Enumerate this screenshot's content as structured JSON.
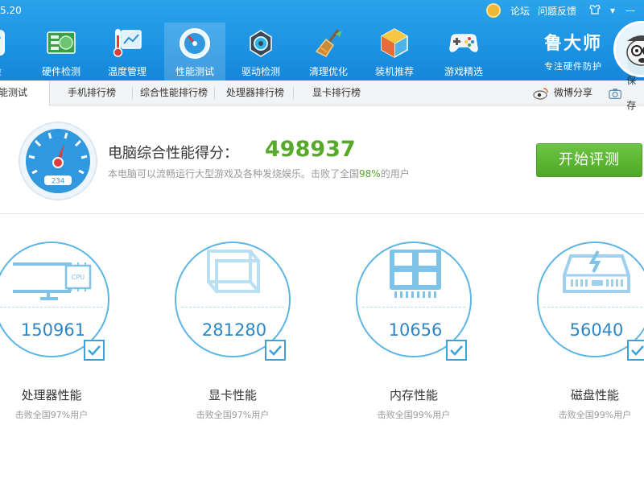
{
  "header": {
    "version": "5.20",
    "links": [
      "论坛",
      "问题反馈"
    ],
    "window_buttons": [
      "▾",
      "—"
    ],
    "brand_title": "鲁大师",
    "brand_subtitle": "专注硬件防护"
  },
  "nav": [
    {
      "label": "体检",
      "icon": "checkup-icon"
    },
    {
      "label": "硬件检测",
      "icon": "hardware-board-icon"
    },
    {
      "label": "温度管理",
      "icon": "thermometer-icon"
    },
    {
      "label": "性能测试",
      "icon": "speedometer-icon",
      "active": true
    },
    {
      "label": "驱动检测",
      "icon": "driver-gear-icon"
    },
    {
      "label": "清理优化",
      "icon": "broom-icon"
    },
    {
      "label": "装机推荐",
      "icon": "cube-icon"
    },
    {
      "label": "游戏精选",
      "icon": "gamepad-icon"
    }
  ],
  "tabs": [
    {
      "label": "性能测试",
      "active": true
    },
    {
      "label": "手机排行榜"
    },
    {
      "label": "综合性能排行榜"
    },
    {
      "label": "处理器排行榜"
    },
    {
      "label": "显卡排行榜"
    }
  ],
  "share": {
    "weibo": "微博分享",
    "save": "保存"
  },
  "score": {
    "label": "电脑综合性能得分：",
    "value": "498937",
    "desc_prefix": "本电脑可以流畅运行大型游戏及各种发烧娱乐。击败了全国",
    "desc_pct": "98%",
    "desc_suffix": "的用户",
    "gauge_readout": "234"
  },
  "start_button": "开始评测",
  "components": [
    {
      "name": "处理器性能",
      "score": "150961",
      "desc": "击败全国97%用户",
      "icon": "cpu-monitor-icon",
      "chip_text": "CPU"
    },
    {
      "name": "显卡性能",
      "score": "281280",
      "desc": "击败全国97%用户",
      "icon": "gpu-cube-icon"
    },
    {
      "name": "内存性能",
      "score": "10656",
      "desc": "击败全国99%用户",
      "icon": "memory-chip-icon"
    },
    {
      "name": "磁盘性能",
      "score": "56040",
      "desc": "击败全国99%用户",
      "icon": "disk-drive-icon"
    }
  ],
  "colors": {
    "header": "#1a8fe0",
    "accent_green": "#58a82a",
    "score_blue": "#2c86c7",
    "ring": "#5bb5e6"
  }
}
